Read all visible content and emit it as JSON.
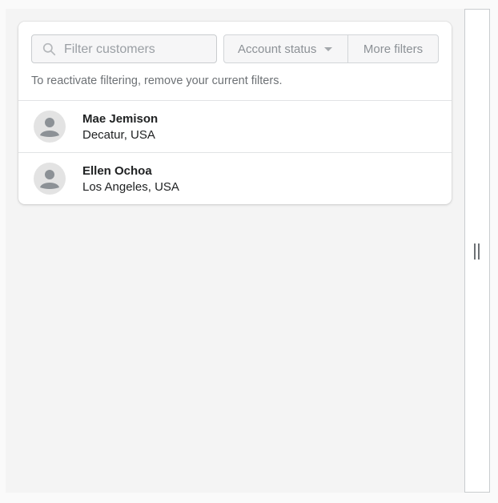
{
  "filters": {
    "search_placeholder": "Filter customers",
    "account_status_label": "Account status",
    "more_filters_label": "More filters"
  },
  "notice": "To reactivate filtering, remove your current filters.",
  "customers": [
    {
      "name": "Mae Jemison",
      "location": "Decatur, USA"
    },
    {
      "name": "Ellen Ochoa",
      "location": "Los Angeles, USA"
    }
  ],
  "icons": {
    "search": "search-icon",
    "caret": "caret-down-icon",
    "avatar": "person-icon",
    "handle": "drag-handle-icon"
  },
  "colors": {
    "text": "#202223",
    "subdued": "#6d7175",
    "avatar_bg": "#e3e3e3"
  }
}
